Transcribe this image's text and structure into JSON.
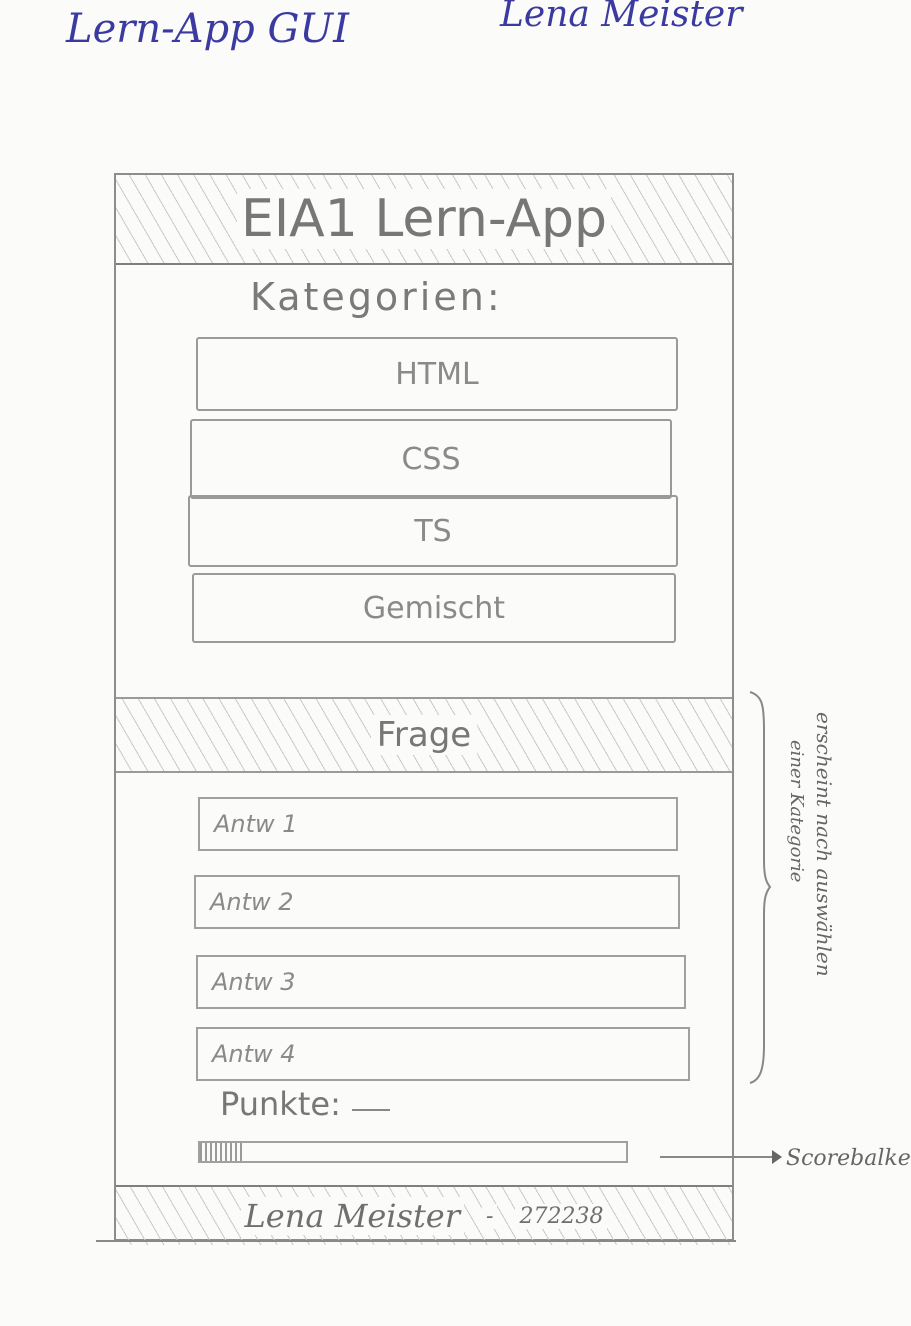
{
  "page": {
    "sheet_title": "Lern-App GUI",
    "author": "Lena Meister"
  },
  "app": {
    "title": "EIA1 Lern-App",
    "categories_label": "Kategorien:",
    "categories": [
      "HTML",
      "CSS",
      "TS",
      "Gemischt"
    ],
    "question_label": "Frage",
    "answers": [
      "Antw 1",
      "Antw 2",
      "Antw 3",
      "Antw 4"
    ],
    "points_label": "Punkte:",
    "score_progress": 0.1,
    "footer": {
      "name": "Lena Meister",
      "separator": "-",
      "id": "272238"
    }
  },
  "annotations": {
    "appears_line1": "erscheint nach auswählen",
    "appears_line2": "einer Kategorie",
    "scorebar_note": "Scorebalken"
  }
}
